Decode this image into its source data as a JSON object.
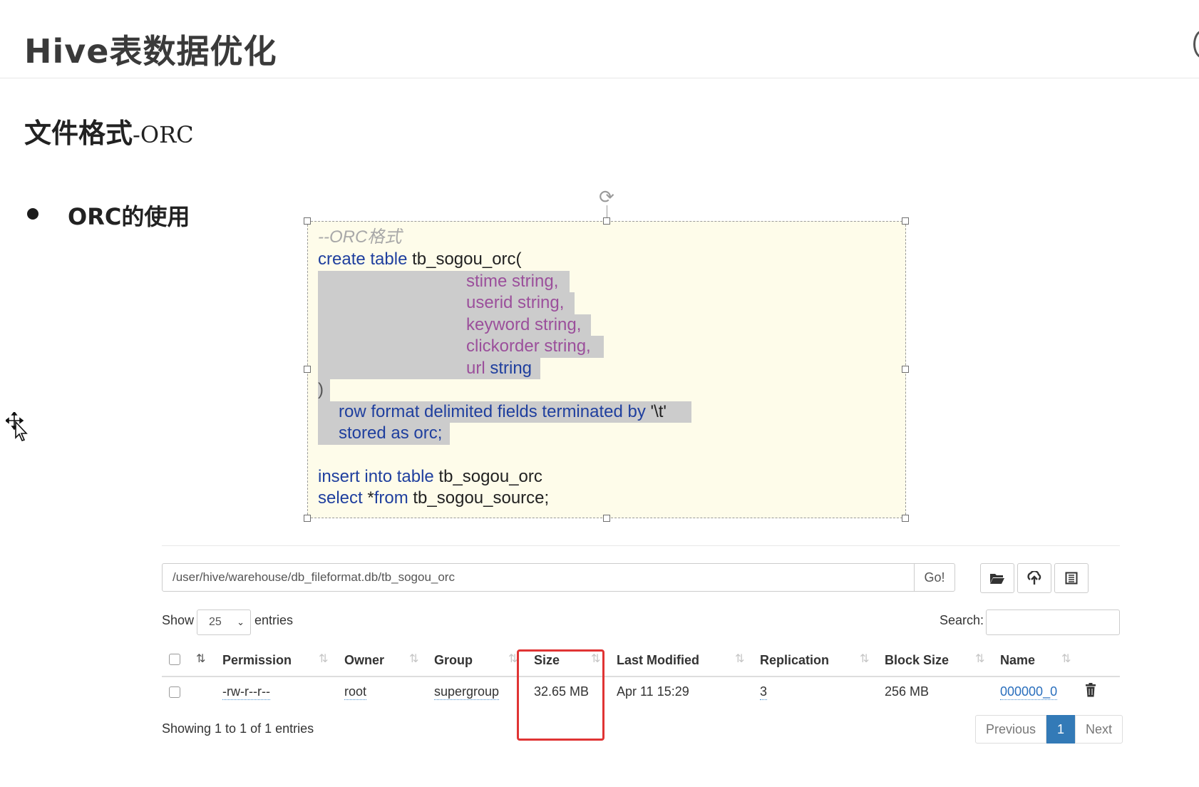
{
  "slide": {
    "title": "Hive表数据优化",
    "subtitle_main": "文件格式",
    "subtitle_suffix": "-ORC",
    "bullet": "ORC的使用"
  },
  "code": {
    "comment": "--ORC格式",
    "create_kw": "create table",
    "create_name": " tb_sogou_orc(",
    "fields": [
      {
        "name": "stime",
        "type": " string,"
      },
      {
        "name": "userid",
        "type": " string,"
      },
      {
        "name": "keyword",
        "type": " string,"
      },
      {
        "name": "clickorder",
        "type": " string,"
      },
      {
        "name": "url",
        "type": " string"
      }
    ],
    "close_paren": ")",
    "row_format": "row format delimited fields terminated by",
    "row_format_delim": " '\\t'",
    "stored_as": "stored as orc;",
    "insert_kw": "insert into table",
    "insert_name": " tb_sogou_orc",
    "select_kw": "select",
    "select_star": " *",
    "from_kw": "from",
    "from_name": " tb_sogou_source;"
  },
  "hdfs": {
    "path_value": "/user/hive/warehouse/db_fileformat.db/tb_sogou_orc",
    "go_label": "Go!",
    "toolbar_icons": [
      "folder-open-icon",
      "upload-icon",
      "cut-icon"
    ],
    "show_label": "Show",
    "entries_value": "25",
    "entries_label": "entries",
    "search_label": "Search:",
    "columns": [
      "Permission",
      "Owner",
      "Group",
      "Size",
      "Last Modified",
      "Replication",
      "Block Size",
      "Name"
    ],
    "row": {
      "permission": "-rw-r--r--",
      "owner": "root",
      "group": "supergroup",
      "size": "32.65 MB",
      "last_modified": "Apr 11 15:29",
      "replication": "3",
      "block_size": "256 MB",
      "name": "000000_0"
    },
    "showing_text": "Showing 1 to 1 of 1 entries",
    "pagination": {
      "previous": "Previous",
      "current": "1",
      "next": "Next"
    },
    "highlight_color": "#e03434",
    "accent_color": "#337ab7"
  }
}
